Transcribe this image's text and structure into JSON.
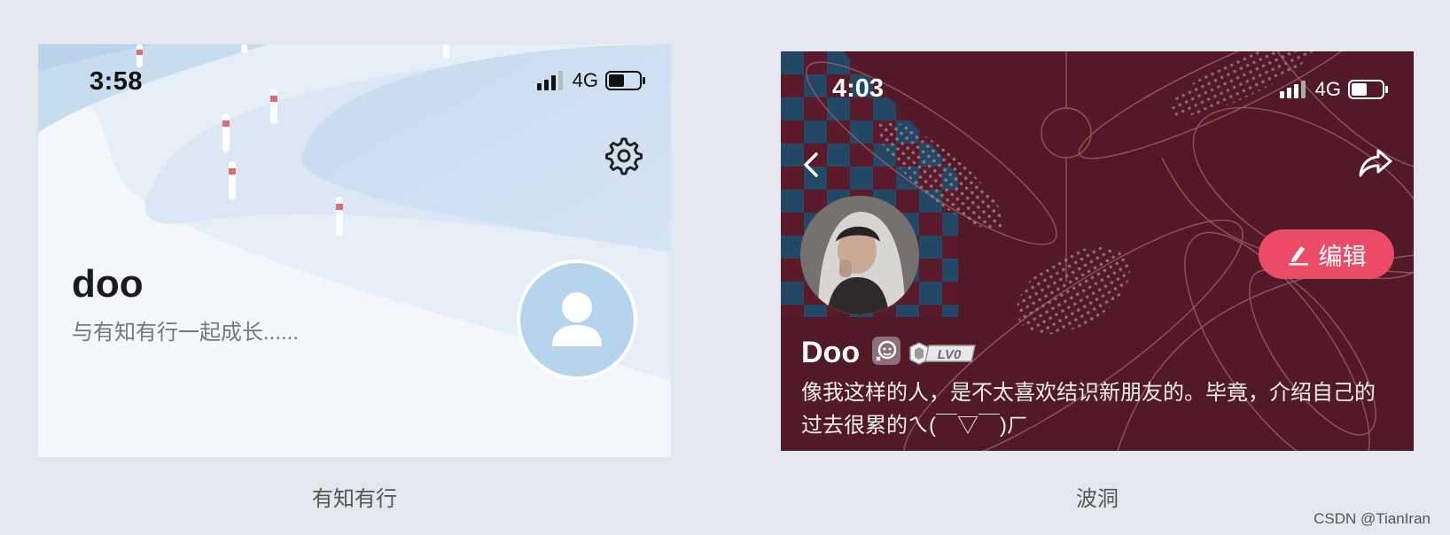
{
  "left_card": {
    "status_bar": {
      "time": "3:58",
      "network": "4G"
    },
    "profile": {
      "name": "doo",
      "bio": "与有知有行一起成长......"
    },
    "caption": "有知有行"
  },
  "right_card": {
    "status_bar": {
      "time": "4:03",
      "network": "4G"
    },
    "edit_button": {
      "label": "编辑"
    },
    "profile": {
      "name": "Doo",
      "level_badge": "LV0",
      "bio": "像我这样的人，是不太喜欢结识新朋友的。毕竟，介绍自己的过去很累的ㄟ(￣▽￣)ㄏ"
    },
    "caption": "波洞"
  },
  "watermark": "CSDN @TianIran",
  "colors": {
    "page_bg": "#e3e8ee",
    "left_avatar": "#b5d4ee",
    "right_bg": "#521a26",
    "edit_button": "#ec4b68"
  }
}
